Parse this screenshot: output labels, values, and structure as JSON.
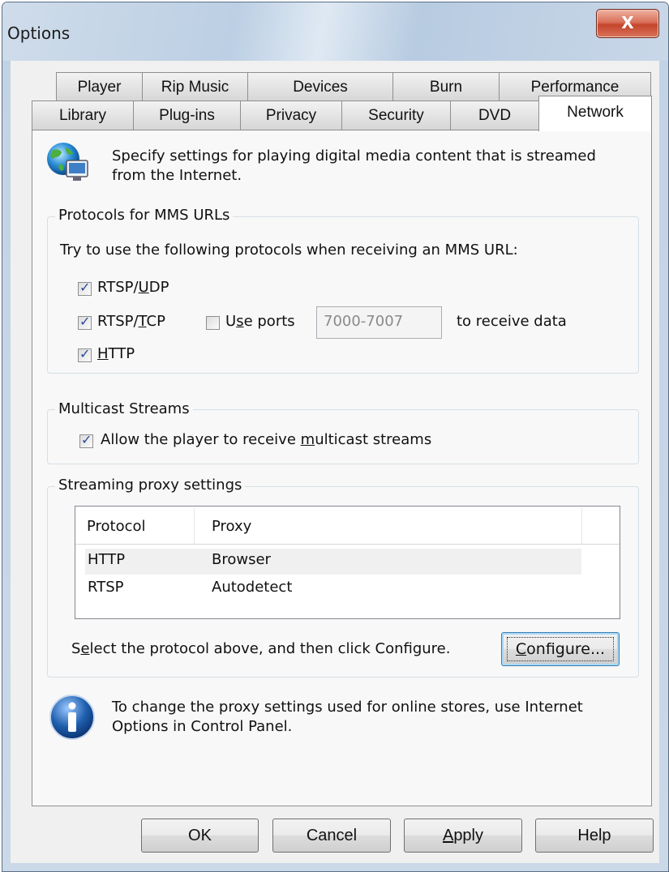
{
  "window": {
    "title": "Options",
    "close_glyph": "X"
  },
  "tabs_row1": [
    {
      "label": "Player"
    },
    {
      "label": "Rip Music"
    },
    {
      "label": "Devices"
    },
    {
      "label": "Burn"
    },
    {
      "label": "Performance"
    }
  ],
  "tabs_row2": [
    {
      "label": "Library"
    },
    {
      "label": "Plug-ins"
    },
    {
      "label": "Privacy"
    },
    {
      "label": "Security"
    },
    {
      "label": "DVD"
    },
    {
      "label": "Network",
      "active": true
    }
  ],
  "header": {
    "icon": "network-globe-icon",
    "line1": "Specify settings for playing digital media content that is streamed",
    "line2": "from the Internet."
  },
  "protocols": {
    "legend": "Protocols for MMS URLs",
    "instruction": "Try to use the following protocols when receiving an MMS URL:",
    "rtsp_udp": {
      "pre": "RTSP/",
      "accel": "U",
      "post": "DP",
      "checked": true
    },
    "rtsp_tcp": {
      "pre": "RTSP/",
      "accel": "T",
      "post": "CP",
      "checked": true
    },
    "use_ports": {
      "pre": "U",
      "accel": "s",
      "post": "e ports",
      "checked": false
    },
    "ports_value": "7000-7007",
    "ports_suffix": "to receive data",
    "http": {
      "pre": "",
      "accel": "H",
      "post": "TTP",
      "checked": true
    }
  },
  "multicast": {
    "legend": "Multicast Streams",
    "allow": {
      "pre": "Allow the player to receive ",
      "accel": "m",
      "post": "ulticast streams",
      "checked": true
    }
  },
  "proxy": {
    "legend": "Streaming proxy settings",
    "columns": [
      "Protocol",
      "Proxy"
    ],
    "rows": [
      {
        "protocol": "HTTP",
        "proxy": "Browser"
      },
      {
        "protocol": "RTSP",
        "proxy": "Autodetect"
      }
    ],
    "hint_pre": "S",
    "hint_accel": "e",
    "hint_post": "lect the protocol above, and then click Configure.",
    "configure": {
      "accel": "C",
      "post": "onfigure..."
    }
  },
  "info": {
    "icon": "info-icon",
    "line1": "To change the proxy settings used for online stores, use Internet",
    "line2": "Options in Control Panel."
  },
  "buttons": {
    "ok": "OK",
    "cancel": "Cancel",
    "apply": {
      "accel": "A",
      "post": "pply"
    },
    "help": "Help"
  },
  "colors": {
    "accent": "#3c7fb1",
    "close": "#c4452b",
    "info_blue": "#1f5fae"
  }
}
